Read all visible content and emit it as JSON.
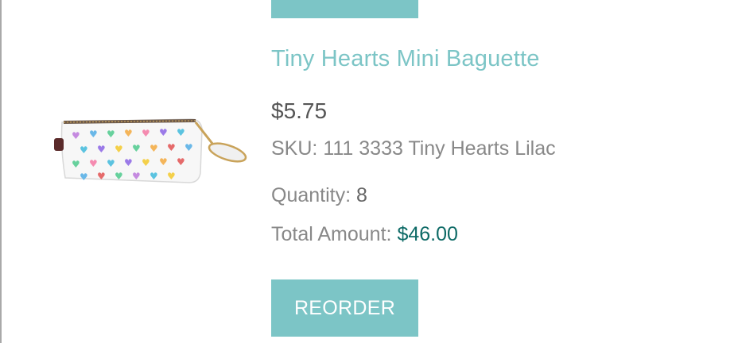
{
  "product": {
    "title": "Tiny Hearts Mini Baguette",
    "price": "$5.75",
    "sku_label": "SKU:",
    "sku_value": "111 3333 Tiny Hearts Lilac",
    "quantity_label": "Quantity:",
    "quantity_value": "8",
    "total_label": "Total Amount:",
    "total_value": "$46.00",
    "image_icon": "pencil-case-hearts-image"
  },
  "actions": {
    "reorder_label": "REORDER"
  },
  "colors": {
    "accent": "#7cc5c6",
    "total_value": "#0d6a66",
    "text_dark": "#555555",
    "text_muted": "#888888"
  }
}
